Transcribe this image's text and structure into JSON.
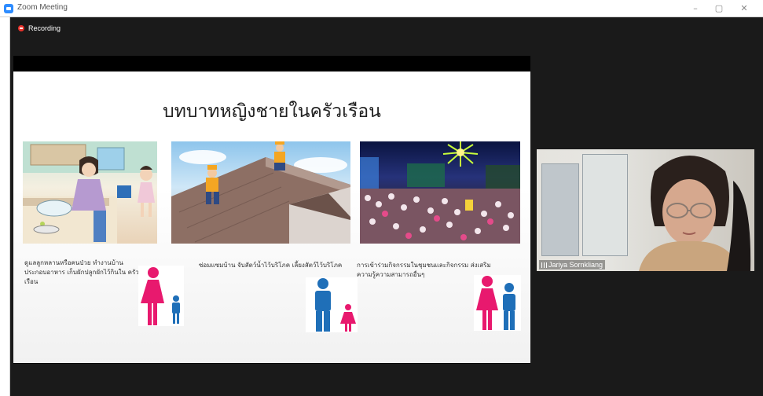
{
  "window": {
    "title": "Zoom Meeting",
    "minimize": "–",
    "maximize": "▢",
    "close": "✕"
  },
  "recording": {
    "label": "Recording"
  },
  "slide": {
    "title": "บทบาทหญิงชายในครัวเรือน",
    "captions": [
      "ดูแลลูกหลานหรือคนป่วย ทำงานบ้าน ประกอบอาหาร เก็บผักปลูกผักไว้กินใน ครัวเรือน",
      "ซ่อมแซมบ้าน จับสัตว์น้ำไว้บริโภค เลี้ยงสัตว์ไว้บริโภค",
      "การเข้าร่วมกิจกรรมในชุมชนและกิจกรรม ส่งเสริมความรู้ความสามารถอื่นๆ"
    ]
  },
  "participant": {
    "name": "Jariya Sornkliang"
  },
  "colors": {
    "female_icon": "#e8196e",
    "male_icon": "#1f6fb8",
    "zoom_blue": "#2d8cff",
    "meeting_bg": "#1a1a1a"
  }
}
